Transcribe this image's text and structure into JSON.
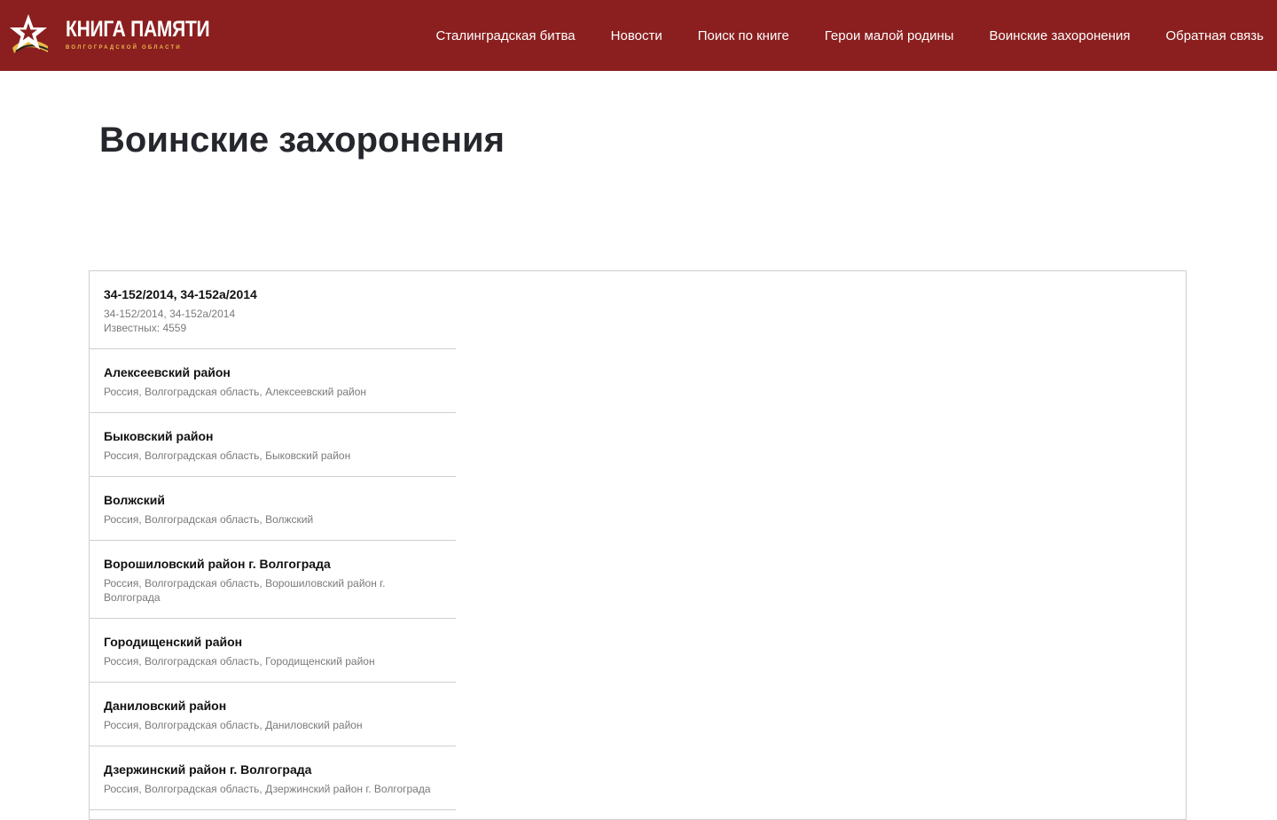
{
  "brand": {
    "title": "КНИГА ПАМЯТИ",
    "subtitle": "ВОЛГОГРАДСКОЙ ОБЛАСТИ",
    "accent_color": "#8b1f1f",
    "logo_icon": "star-with-ribbon-icon"
  },
  "nav": {
    "items": [
      {
        "label": "Сталинградская битва"
      },
      {
        "label": "Новости"
      },
      {
        "label": "Поиск по книге"
      },
      {
        "label": "Герои малой родины"
      },
      {
        "label": "Воинские захоронения"
      },
      {
        "label": "Обратная связь"
      }
    ]
  },
  "page": {
    "title": "Воинские захоронения"
  },
  "burials": {
    "items": [
      {
        "title": "34-152/2014, 34-152а/2014",
        "subtitle": "34-152/2014, 34-152а/2014",
        "extra": "Известных: 4559"
      },
      {
        "title": "Алексеевский район",
        "subtitle": "Россия, Волгоградская область, Алексеевский район"
      },
      {
        "title": "Быковский район",
        "subtitle": "Россия, Волгоградская область, Быковский район"
      },
      {
        "title": "Волжский",
        "subtitle": "Россия, Волгоградская область, Волжский"
      },
      {
        "title": "Ворошиловский район г. Волгограда",
        "subtitle": "Россия, Волгоградская область, Ворошиловский район г. Волгограда"
      },
      {
        "title": "Городищенский район",
        "subtitle": "Россия, Волгоградская область, Городищенский район"
      },
      {
        "title": "Даниловский район",
        "subtitle": "Россия, Волгоградская область, Даниловский район"
      },
      {
        "title": "Дзержинский район г. Волгограда",
        "subtitle": "Россия, Волгоградская область, Дзержинский район г. Волгограда"
      }
    ]
  }
}
